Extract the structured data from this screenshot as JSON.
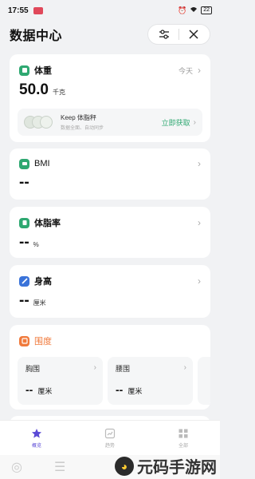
{
  "status": {
    "time": "17:55",
    "badge": "APP",
    "battery": "22"
  },
  "header": {
    "title": "数据中心"
  },
  "weight": {
    "name": "体重",
    "today": "今天",
    "value": "50.0",
    "unit": "千克",
    "scale": {
      "name": "Keep 体脂秤",
      "desc": "数据全面、自动同步",
      "action": "立即获取"
    }
  },
  "bmi": {
    "name": "BMI",
    "value": "--"
  },
  "bodyfat": {
    "name": "体脂率",
    "value": "--",
    "unit": "%"
  },
  "height": {
    "name": "身高",
    "value": "--",
    "unit": "厘米"
  },
  "circumference": {
    "name": "围度",
    "items": [
      {
        "label": "胸围",
        "value": "--",
        "unit": "厘米"
      },
      {
        "label": "腰围",
        "value": "--",
        "unit": "厘米"
      }
    ]
  },
  "nav": {
    "items": [
      {
        "label": "概览"
      },
      {
        "label": "趋势"
      },
      {
        "label": "全部"
      }
    ]
  },
  "watermark": {
    "text": "元码手游网"
  },
  "colors": {
    "green": "#2ea871",
    "purple": "#5b4ad6",
    "orange": "#f07a3c",
    "blue": "#3a73d9"
  }
}
